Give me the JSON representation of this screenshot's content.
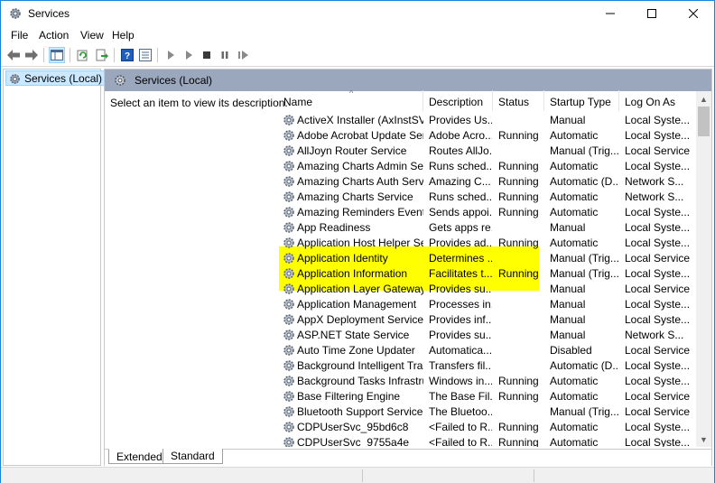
{
  "window": {
    "title": "Services",
    "accent": "#1883d7"
  },
  "menu": [
    "File",
    "Action",
    "View",
    "Help"
  ],
  "tree": {
    "root_label": "Services (Local)"
  },
  "pane": {
    "header": "Services (Local)",
    "description_prompt": "Select an item to view its description."
  },
  "columns": [
    "Name",
    "Description",
    "Status",
    "Startup Type",
    "Log On As"
  ],
  "highlight_color": "#ffff00",
  "services": [
    {
      "name": "ActiveX Installer (AxInstSV)",
      "description": "Provides Us...",
      "status": "",
      "startup": "Manual",
      "logon": "Local Syste..."
    },
    {
      "name": "Adobe Acrobat Update Serv...",
      "description": "Adobe Acro...",
      "status": "Running",
      "startup": "Automatic",
      "logon": "Local Syste..."
    },
    {
      "name": "AllJoyn Router Service",
      "description": "Routes AllJo...",
      "status": "",
      "startup": "Manual (Trig...",
      "logon": "Local Service"
    },
    {
      "name": "Amazing Charts Admin Ser...",
      "description": "Runs sched...",
      "status": "Running",
      "startup": "Automatic",
      "logon": "Local Syste..."
    },
    {
      "name": "Amazing Charts Auth Service",
      "description": "Amazing C...",
      "status": "Running",
      "startup": "Automatic (D...",
      "logon": "Network S..."
    },
    {
      "name": "Amazing Charts Service",
      "description": "Runs sched...",
      "status": "Running",
      "startup": "Automatic",
      "logon": "Network S..."
    },
    {
      "name": "Amazing Reminders Event S...",
      "description": "Sends appoi...",
      "status": "Running",
      "startup": "Automatic",
      "logon": "Local Syste..."
    },
    {
      "name": "App Readiness",
      "description": "Gets apps re...",
      "status": "",
      "startup": "Manual",
      "logon": "Local Syste..."
    },
    {
      "name": "Application Host Helper Ser...",
      "description": "Provides ad...",
      "status": "Running",
      "startup": "Automatic",
      "logon": "Local Syste..."
    },
    {
      "name": "Application Identity",
      "description": "Determines ...",
      "status": "",
      "startup": "Manual (Trig...",
      "logon": "Local Service"
    },
    {
      "name": "Application Information",
      "description": "Facilitates t...",
      "status": "Running",
      "startup": "Manual (Trig...",
      "logon": "Local Syste..."
    },
    {
      "name": "Application Layer Gateway ...",
      "description": "Provides su...",
      "status": "",
      "startup": "Manual",
      "logon": "Local Service"
    },
    {
      "name": "Application Management",
      "description": "Processes in...",
      "status": "",
      "startup": "Manual",
      "logon": "Local Syste..."
    },
    {
      "name": "AppX Deployment Service (...",
      "description": "Provides inf...",
      "status": "",
      "startup": "Manual",
      "logon": "Local Syste..."
    },
    {
      "name": "ASP.NET State Service",
      "description": "Provides su...",
      "status": "",
      "startup": "Manual",
      "logon": "Network S..."
    },
    {
      "name": "Auto Time Zone Updater",
      "description": "Automatica...",
      "status": "",
      "startup": "Disabled",
      "logon": "Local Service"
    },
    {
      "name": "Background Intelligent Tran...",
      "description": "Transfers fil...",
      "status": "",
      "startup": "Automatic (D...",
      "logon": "Local Syste..."
    },
    {
      "name": "Background Tasks Infrastru...",
      "description": "Windows in...",
      "status": "Running",
      "startup": "Automatic",
      "logon": "Local Syste..."
    },
    {
      "name": "Base Filtering Engine",
      "description": "The Base Fil...",
      "status": "Running",
      "startup": "Automatic",
      "logon": "Local Service"
    },
    {
      "name": "Bluetooth Support Service",
      "description": "The Bluetoo...",
      "status": "",
      "startup": "Manual (Trig...",
      "logon": "Local Service"
    },
    {
      "name": "CDPUserSvc_95bd6c8",
      "description": "<Failed to R...",
      "status": "Running",
      "startup": "Automatic",
      "logon": "Local Syste..."
    },
    {
      "name": "CDPUserSvc_9755a4e",
      "description": "<Failed to R...",
      "status": "Running",
      "startup": "Automatic",
      "logon": "Local Syste..."
    }
  ],
  "tabs": [
    "Extended",
    "Standard"
  ]
}
